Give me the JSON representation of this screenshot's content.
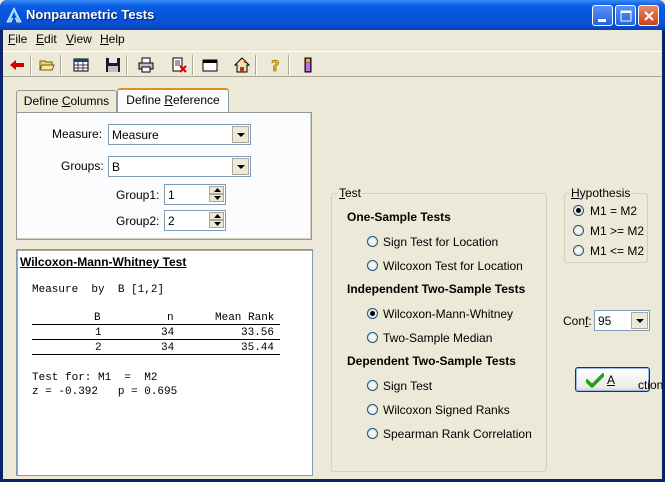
{
  "window": {
    "title": "Nonparametric Tests"
  },
  "menu": [
    {
      "label": "File",
      "key": "F",
      "rest": "ile"
    },
    {
      "label": "Edit",
      "key": "E",
      "rest": "dit"
    },
    {
      "label": "View",
      "key": "V",
      "rest": "iew"
    },
    {
      "label": "Help",
      "key": "H",
      "rest": "elp"
    }
  ],
  "toolbar_icons": [
    "back-arrow-icon",
    "open-folder-icon",
    "grid-icon",
    "save-icon",
    "print-icon",
    "delete-doc-icon",
    "window-icon",
    "home-icon",
    "help-icon",
    "exit-icon"
  ],
  "tabs": {
    "define_columns": {
      "pre": "Define ",
      "key": "C",
      "post": "olumns"
    },
    "define_reference": {
      "pre": "Define ",
      "key": "R",
      "post": "eference"
    }
  },
  "form": {
    "measure_label": "Measure:",
    "measure_value": "Measure",
    "groups_label": "Groups:",
    "groups_value": "B",
    "group1_label": "Group1:",
    "group1_value": "1",
    "group2_label": "Group2:",
    "group2_value": "2"
  },
  "results": {
    "title": "Wilcoxon-Mann-Whitney Test",
    "subtitle": "Measure  by  B [1,2]",
    "columns": [
      "B",
      "n",
      "Mean Rank"
    ],
    "rows": [
      {
        "b": "1",
        "n": "34",
        "rank": "33.56"
      },
      {
        "b": "2",
        "n": "34",
        "rank": "35.44"
      }
    ],
    "test_for": "Test for: M1  =  M2",
    "stats": "z = -0.392   p = 0.695"
  },
  "test_group": {
    "title_key": "T",
    "title_rest": "est",
    "sections": {
      "one_sample": "One-Sample Tests",
      "independent": "Independent Two-Sample Tests",
      "dependent": "Dependent Two-Sample Tests"
    },
    "options": {
      "sign_location": "Sign Test for Location",
      "wilcoxon_location": "Wilcoxon Test for Location",
      "wmw": "Wilcoxon-Mann-Whitney",
      "median": "Two-Sample Median",
      "sign": "Sign Test",
      "signed_ranks": "Wilcoxon Signed Ranks",
      "spearman": "Spearman Rank Correlation"
    },
    "selected": "wmw"
  },
  "hypothesis": {
    "title_key": "H",
    "title_rest": "ypothesis",
    "options": [
      "M1  =  M2",
      "M1 >= M2",
      "M1 <= M2"
    ],
    "selected_index": 0
  },
  "conf": {
    "label_pre": "Con",
    "label_key": "f",
    "label_post": ":",
    "value": "95"
  },
  "action": {
    "key": "A",
    "rest": "ction"
  },
  "colors": {
    "titlebar": "#0655dd",
    "face": "#ece9d8",
    "check": "#21a121"
  }
}
